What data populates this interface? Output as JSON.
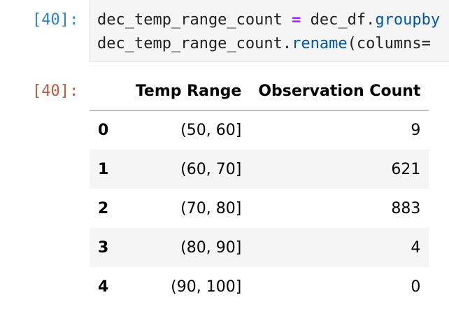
{
  "cells": {
    "input": {
      "prompt": "[40]:",
      "line1": {
        "var": "dec_temp_range_count",
        "space1": " ",
        "op": "=",
        "space2": " ",
        "obj": "dec_df.",
        "method": "groupby"
      },
      "line2": {
        "var": "dec_temp_range_count.",
        "method": "rename",
        "rest": "(columns="
      }
    },
    "output": {
      "prompt": "[40]:",
      "table": {
        "columns": [
          "",
          "Temp Range",
          "Observation Count"
        ],
        "rows": [
          {
            "index": "0",
            "temp_range": "(50, 60]",
            "count": "9"
          },
          {
            "index": "1",
            "temp_range": "(60, 70]",
            "count": "621"
          },
          {
            "index": "2",
            "temp_range": "(70, 80]",
            "count": "883"
          },
          {
            "index": "3",
            "temp_range": "(80, 90]",
            "count": "4"
          },
          {
            "index": "4",
            "temp_range": "(90, 100]",
            "count": "0"
          }
        ]
      }
    }
  },
  "colors": {
    "in_prompt": "#307fc1",
    "out_prompt": "#bf5b3d",
    "code_bg": "#f5f5f5",
    "operator": "#aa22ff",
    "method": "#0056a0",
    "row_stripe": "#f5f5f5"
  }
}
